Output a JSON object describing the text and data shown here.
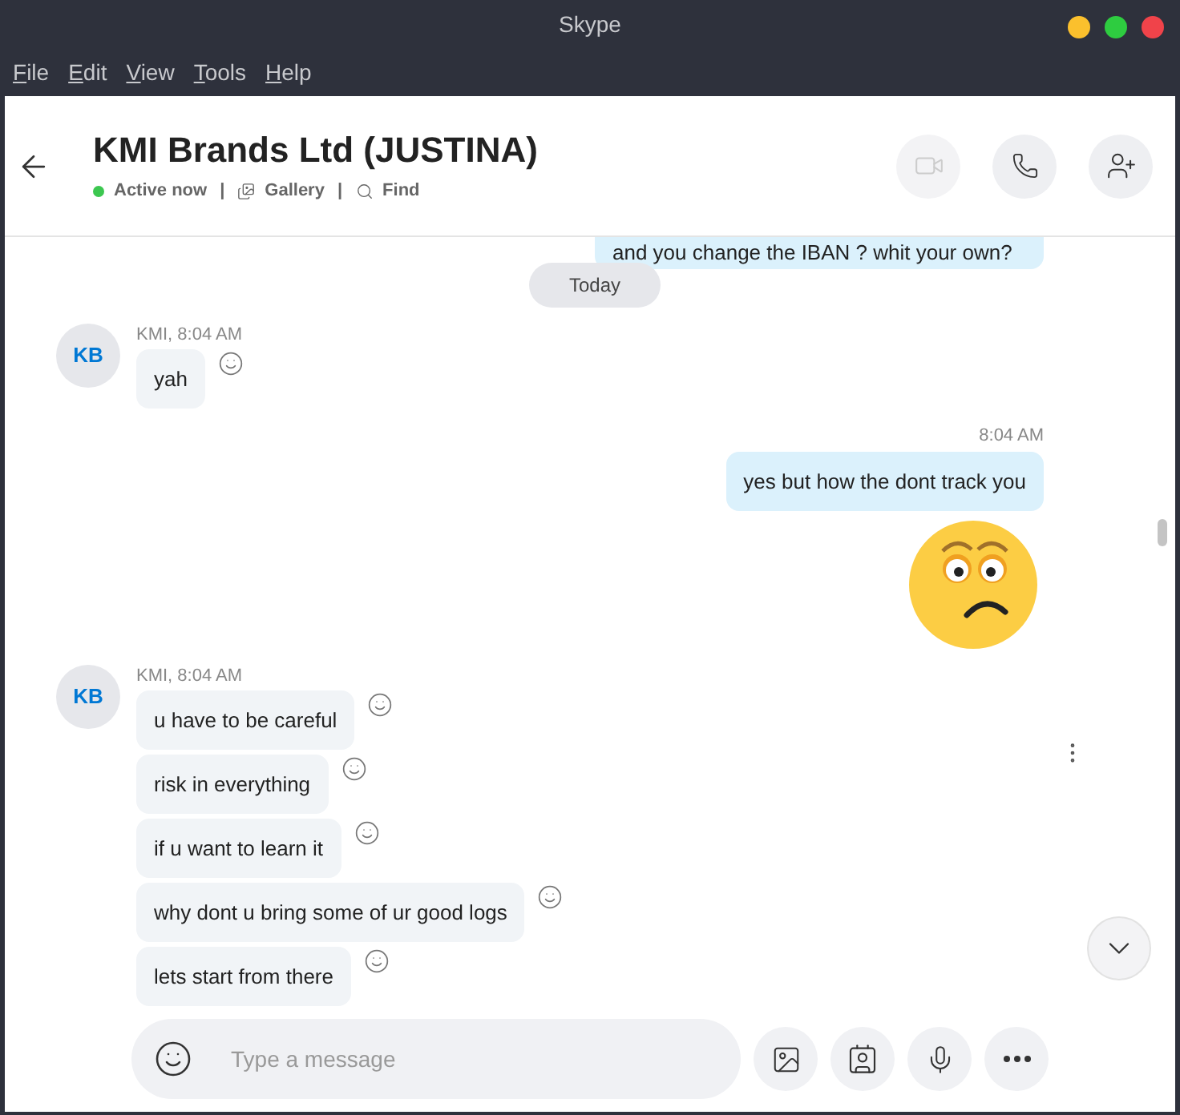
{
  "window": {
    "title": "Skype"
  },
  "menu": [
    "File",
    "Edit",
    "View",
    "Tools",
    "Help"
  ],
  "header": {
    "title": "KMI Brands Ltd (JUSTINA)",
    "status": "Active now",
    "online": true,
    "separator": "|",
    "links": [
      "Gallery",
      "Find"
    ]
  },
  "messages": [
    {
      "kind": "partial",
      "text": "and you change the IBAN ? whit your own?"
    },
    {
      "kind": "divider",
      "text": "Today"
    },
    {
      "kind": "incoming",
      "avatar": "KB",
      "sender": "KMI, 8:04 AM",
      "bubbles": [
        "yah"
      ]
    },
    {
      "kind": "outgoing",
      "time": "8:04 AM",
      "text": "yes but how the dont track you"
    },
    {
      "kind": "emoji"
    },
    {
      "kind": "incoming",
      "avatar": "KB",
      "sender": "KMI, 8:04 AM",
      "bubbles": [
        "u have to be careful",
        "risk in everything",
        "if u want to learn it",
        "why dont u bring some of ur good logs",
        "lets start from there"
      ]
    }
  ],
  "composer": {
    "placeholder": "Type a message"
  }
}
